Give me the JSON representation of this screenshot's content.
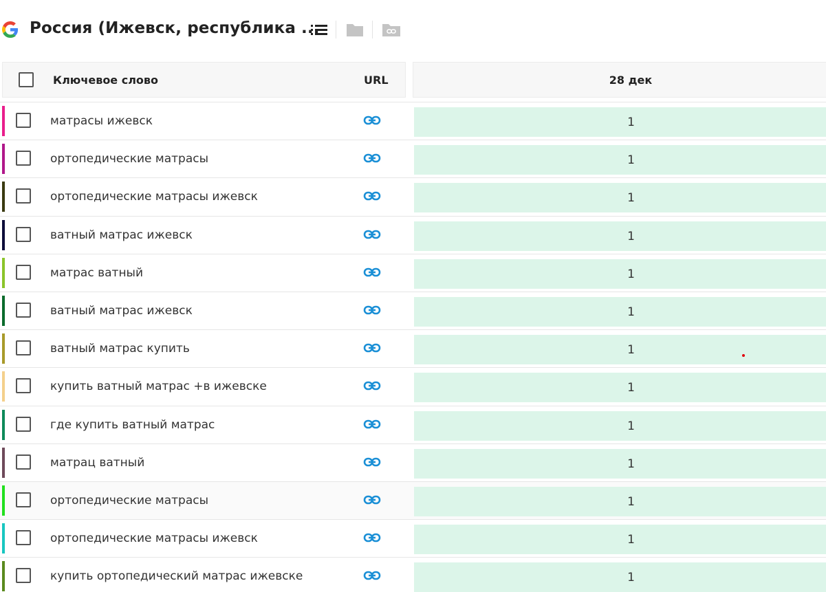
{
  "toolbar": {
    "logo_icon": "google-g-icon",
    "title": "Россия (Ижевск, республика ...",
    "list_icon": "list-icon",
    "folder_icon": "folder-icon",
    "link_folder_icon": "link-folder-icon"
  },
  "table": {
    "headers": {
      "keyword": "Ключевое слово",
      "url": "URL",
      "date": "28 дек"
    },
    "rows": [
      {
        "keyword": "матрасы ижевск",
        "position": "1",
        "color": "#e91e8c"
      },
      {
        "keyword": "ортопедические матрасы",
        "position": "1",
        "color": "#b0178a"
      },
      {
        "keyword": "ортопедические матрасы ижевск",
        "position": "1",
        "color": "#3a3a10"
      },
      {
        "keyword": "ватный матрас ижевск",
        "position": "1",
        "color": "#0d0d3a"
      },
      {
        "keyword": "матрас ватный",
        "position": "1",
        "color": "#8bc42a"
      },
      {
        "keyword": "ватный матрас ижевск",
        "position": "1",
        "color": "#0b6b2c"
      },
      {
        "keyword": "ватный матрас купить",
        "position": "1",
        "color": "#a89a2a"
      },
      {
        "keyword": "купить ватный матрас +в ижевске",
        "position": "1",
        "color": "#f4d08c"
      },
      {
        "keyword": "где купить ватный матрас",
        "position": "1",
        "color": "#0e8a5a"
      },
      {
        "keyword": "матрац ватный",
        "position": "1",
        "color": "#6e4a5a"
      },
      {
        "keyword": "ортопедические матрасы",
        "position": "1",
        "color": "#22e01e"
      },
      {
        "keyword": "ортопедические матрасы ижевск",
        "position": "1",
        "color": "#18c6c0"
      },
      {
        "keyword": "купить ортопедический матрас ижевске",
        "position": "1",
        "color": "#5a8a1e"
      }
    ]
  },
  "colors": {
    "link": "#1a8fd6",
    "position_bg": "#dcf5e9"
  }
}
